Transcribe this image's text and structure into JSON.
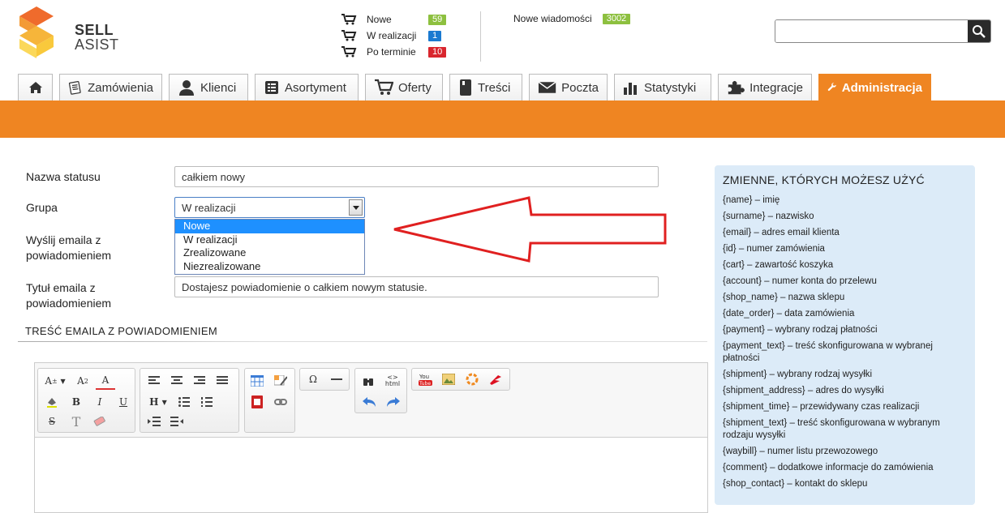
{
  "header": {
    "logo_line1": "SELL",
    "logo_line2": "ASIST",
    "orders": [
      {
        "label": "Nowe",
        "count": "59",
        "color": "#8dc03f"
      },
      {
        "label": "W realizacji",
        "count": "1",
        "color": "#1a7ad1"
      },
      {
        "label": "Po terminie",
        "count": "10",
        "color": "#d9262e"
      }
    ],
    "messages": {
      "label": "Nowe wiadomości",
      "count": "3002",
      "color": "#8dc03f"
    },
    "search": {
      "value": "",
      "placeholder": ""
    }
  },
  "nav": {
    "home_icon": "home-icon",
    "tabs": [
      {
        "label": "Zamówienia",
        "icon": "orders-icon"
      },
      {
        "label": "Klienci",
        "icon": "user-icon"
      },
      {
        "label": "Asortyment",
        "icon": "catalog-icon"
      },
      {
        "label": "Oferty",
        "icon": "cart-icon"
      },
      {
        "label": "Treści",
        "icon": "document-icon"
      },
      {
        "label": "Poczta",
        "icon": "mail-icon"
      },
      {
        "label": "Statystyki",
        "icon": "stats-icon"
      },
      {
        "label": "Integracje",
        "icon": "puzzle-icon"
      },
      {
        "label": "Administracja",
        "icon": "wrench-icon",
        "active": true
      }
    ],
    "accent": "#ef8522"
  },
  "form": {
    "status_name_label": "Nazwa statusu",
    "status_name_value": "całkiem nowy",
    "group_label": "Grupa",
    "group_value": "W realizacji",
    "group_options": [
      "Nowe",
      "W realizacji",
      "Zrealizowane",
      "Niezrealizowane"
    ],
    "group_highlighted": "Nowe",
    "send_email_label_1": "Wyślij emaila z",
    "send_email_label_2": "powiadomieniem",
    "email_title_label_1": "Tytuł emaila z",
    "email_title_label_2": "powiadomieniem",
    "email_title_value": "Dostajesz powiadomienie o całkiem nowym statusie.",
    "email_body_header": "TREŚĆ EMAILA Z POWIADOMIENIEM",
    "email_body_value": ""
  },
  "panel": {
    "title": "ZMIENNE, KTÓRYCH MOŻESZ UŻYĆ",
    "vars": [
      "{name} – imię",
      "{surname} – nazwisko",
      "{email} – adres email klienta",
      "{id} – numer zamówienia",
      "{cart} – zawartość koszyka",
      "{account} – numer konta do przelewu",
      "{shop_name} – nazwa sklepu",
      "{date_order} – data zamówienia",
      "{payment} – wybrany rodzaj płatności",
      "{payment_text} – treść skonfigurowana w wybranej płatności",
      "{shipment} – wybrany rodzaj wysyłki",
      "{shipment_address} – adres do wysyłki",
      "{shipment_time} – przewidywany czas realizacji",
      "{shipment_text} – treść skonfigurowana w wybranym rodzaju wysyłki",
      "{waybill} – numer listu przewozowego",
      "{comment} – dodatkowe informacje do zamówienia",
      "{shop_contact} – kontakt do sklepu"
    ]
  }
}
